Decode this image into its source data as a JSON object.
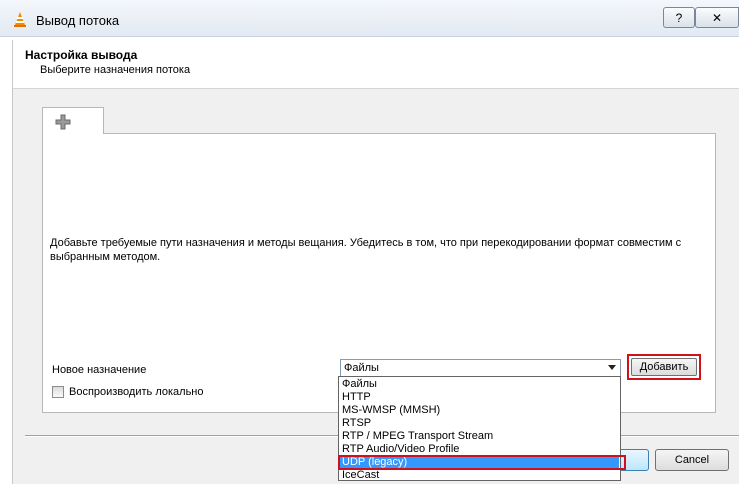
{
  "window": {
    "title": "Вывод потока",
    "help_label": "?",
    "close_label": "✕"
  },
  "header": {
    "title": "Настройка вывода",
    "subtitle": "Выберите назначения потока"
  },
  "tabs": [
    {
      "icon": "plus-icon"
    }
  ],
  "panel": {
    "description": "Добавьте требуемые пути назначения и методы вещания. Убедитесь в том, что при перекодировании формат совместим с выбранным методом.",
    "destination_label": "Новое назначение",
    "destination_select": {
      "value": "Файлы",
      "options": [
        "Файлы",
        "HTTP",
        "MS-WMSP (MMSH)",
        "RTSP",
        "RTP / MPEG Transport Stream",
        "RTP Audio/Video Profile",
        "UDP (legacy)",
        "IceCast"
      ],
      "highlighted_option": "UDP (legacy)"
    },
    "add_button": "Добавить",
    "play_locally_label": "Воспроизводить локально",
    "play_locally_checked": false
  },
  "footer": {
    "next_label": "",
    "cancel_label": "Cancel"
  },
  "colors": {
    "highlight_frame": "#d0101a",
    "selection": "#3399ff"
  }
}
